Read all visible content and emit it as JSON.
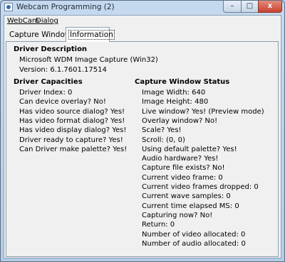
{
  "window": {
    "title": "Webcam Programming (2)",
    "buttons": {
      "minimize": "–",
      "maximize": "□",
      "close": "x"
    }
  },
  "menu": [
    "WebCam",
    "Dialog"
  ],
  "tabs": [
    "Capture Window",
    "Information"
  ],
  "driver_description": {
    "heading": "Driver Description",
    "name": "Microsoft WDM Image Capture (Win32)",
    "version": "Version:  6.1.7601.17514"
  },
  "driver_capacities": {
    "heading": "Driver Capacities",
    "items": [
      "Driver Index: 0",
      "Can device overlay? No!",
      "Has video source dialog? Yes!",
      "Has video format dialog? Yes!",
      "Has video display dialog? Yes!",
      "Driver ready to capture? Yes!",
      "Can Driver make palette? Yes!"
    ]
  },
  "capture_window_status": {
    "heading": "Capture Window Status",
    "items": [
      "Image Width: 640",
      "Image Height: 480",
      "Live window? Yes! (Preview mode)",
      "Overlay window? No!",
      "Scale? Yes!",
      "Scroll: (0, 0)",
      "Using default palette? Yes!",
      "Audio hardware? Yes!",
      "Capture file exists? No!",
      "Current video frame: 0",
      "Current video frames dropped: 0",
      "Current wave samples: 0",
      "Current time elapsed MS: 0",
      "Capturing now? No!",
      "Return: 0",
      "Number of video allocated: 0",
      "Number of audio allocated: 0"
    ]
  }
}
